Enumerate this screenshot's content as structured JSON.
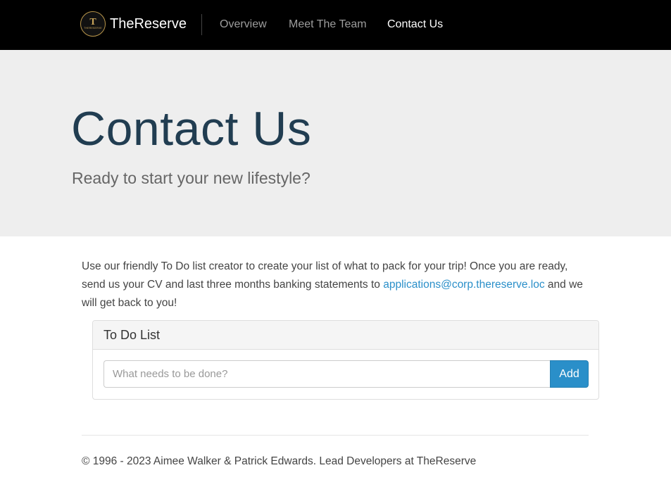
{
  "navbar": {
    "brand_name": "TheReserve",
    "logo_glyph": "T",
    "logo_text": "THERESERVE",
    "links": [
      {
        "label": "Overview",
        "active": false
      },
      {
        "label": "Meet The Team",
        "active": false
      },
      {
        "label": "Contact Us",
        "active": true
      }
    ]
  },
  "hero": {
    "title": "Contact Us",
    "subtitle": "Ready to start your new lifestyle?"
  },
  "intro": {
    "text_before": "Use our friendly To Do list creator to create your list of what to pack for your trip! Once you are ready, send us your CV and last three months banking statements to ",
    "email": "applications@corp.thereserve.loc",
    "text_after": " and we will get back to you!"
  },
  "todo": {
    "heading": "To Do List",
    "input_value": "",
    "input_placeholder": "What needs to be done?",
    "add_label": "Add"
  },
  "footer": {
    "text": "© 1996 - 2023 Aimee Walker & Patrick Edwards. Lead Developers at TheReserve"
  },
  "colors": {
    "navbar_bg": "#000000",
    "hero_bg": "#eeeeee",
    "hero_title": "#213d51",
    "accent": "#2a8fc9",
    "logo_gold": "#b8954a"
  }
}
